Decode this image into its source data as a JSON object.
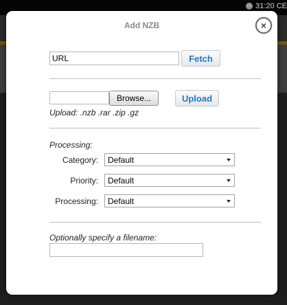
{
  "background": {
    "clock": "31:20 CE"
  },
  "modal": {
    "title": "Add NZB",
    "close_icon": "×",
    "url": {
      "value": "URL",
      "fetch_label": "Fetch"
    },
    "upload": {
      "file_value": "",
      "browse_label": "Browse...",
      "upload_label": "Upload",
      "hint": "Upload: .nzb .rar .zip .gz"
    },
    "processing": {
      "heading": "Processing:",
      "rows": [
        {
          "label": "Category:",
          "value": "Default"
        },
        {
          "label": "Priority:",
          "value": "Default"
        },
        {
          "label": "Processing:",
          "value": "Default"
        }
      ]
    },
    "filename": {
      "label": "Optionally specify a filename:",
      "value": ""
    }
  },
  "colors": {
    "accent_button_text": "#2c76b5",
    "title_text": "#8a8a8a",
    "backdrop": "#1c1c1c"
  }
}
